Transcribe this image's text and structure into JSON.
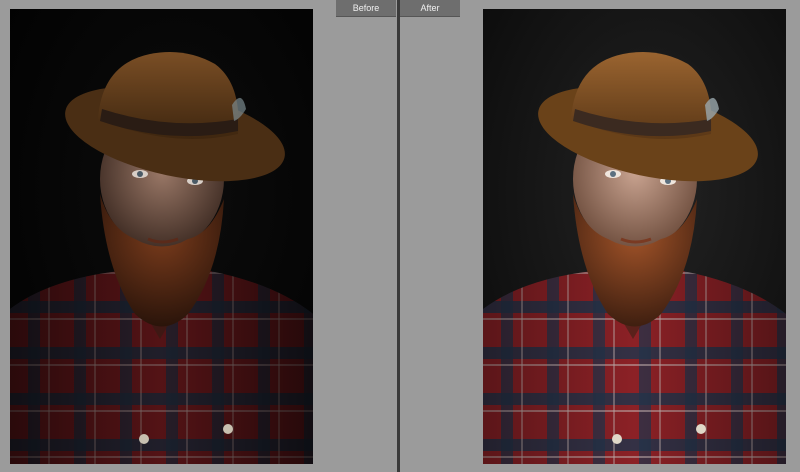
{
  "compare": {
    "before_label": "Before",
    "after_label": "After"
  },
  "colors": {
    "background": "#9b9b9b",
    "divider": "#3a3a3a",
    "tab_bg": "#6e6e6e",
    "hat": "#7a4a22",
    "hat_band": "#3b2a20",
    "beard": "#7a3f1f",
    "shirt_red": "#7e1e22",
    "shirt_blue": "#1d2a3b"
  },
  "photos": [
    {
      "id": "before",
      "exposure": "dark"
    },
    {
      "id": "after",
      "exposure": "bright"
    }
  ]
}
